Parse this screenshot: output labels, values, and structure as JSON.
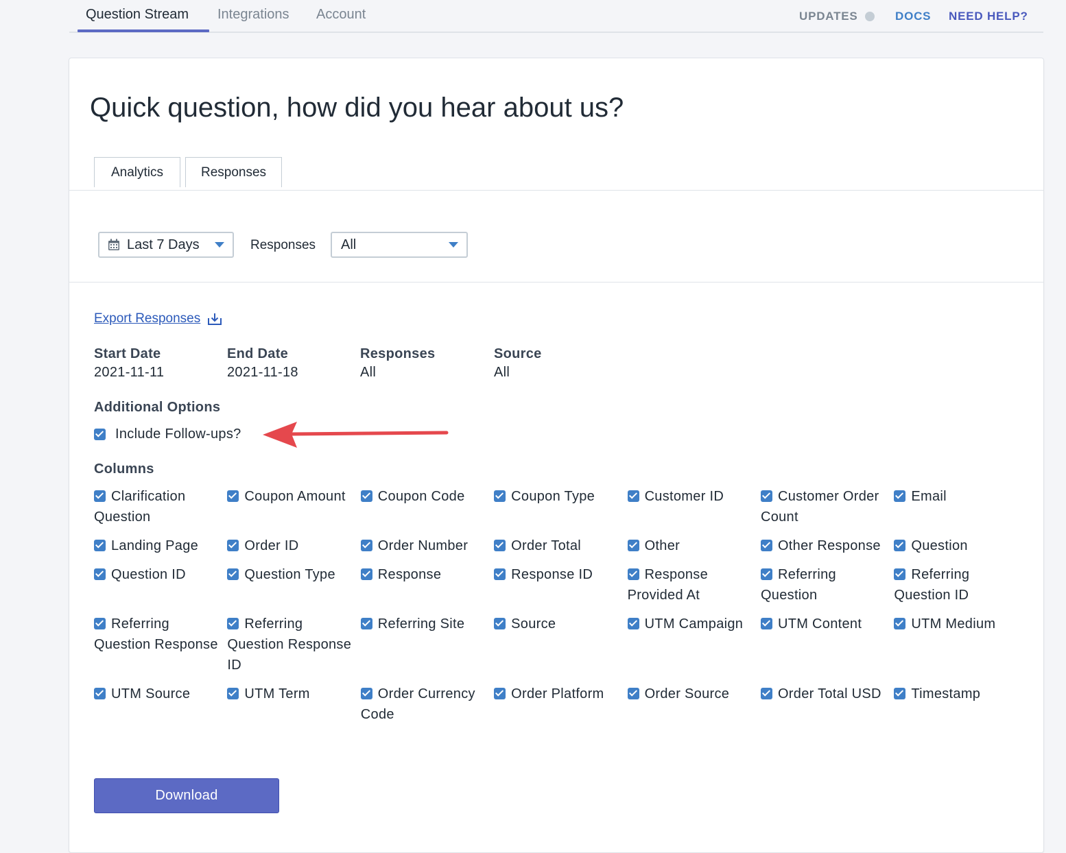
{
  "nav": {
    "tabs": [
      {
        "label": "Question Stream"
      },
      {
        "label": "Integrations"
      },
      {
        "label": "Account"
      }
    ],
    "updates": "UPDATES",
    "docs": "DOCS",
    "help": "NEED HELP?"
  },
  "page": {
    "title": "Quick question, how did you hear about us?"
  },
  "tabs": {
    "analytics": "Analytics",
    "responses": "Responses"
  },
  "filters": {
    "date_range": "Last 7 Days",
    "responses_label": "Responses",
    "responses_value": "All"
  },
  "export": {
    "label": "Export Responses"
  },
  "summary": {
    "start_date_label": "Start Date",
    "start_date": "2021-11-11",
    "end_date_label": "End Date",
    "end_date": "2021-11-18",
    "responses_label": "Responses",
    "responses": "All",
    "source_label": "Source",
    "source": "All"
  },
  "options": {
    "heading": "Additional Options",
    "include_followups": "Include Follow-ups?"
  },
  "columns": {
    "heading": "Columns",
    "items": [
      "Clarification Question",
      "Coupon Amount",
      "Coupon Code",
      "Coupon Type",
      "Customer ID",
      "Customer Order Count",
      "Email",
      "Landing Page",
      "Order ID",
      "Order Number",
      "Order Total",
      "Other",
      "Other Response",
      "Question",
      "Question ID",
      "Question Type",
      "Response",
      "Response ID",
      "Response Provided At",
      "Referring Question",
      "Referring Question ID",
      "Referring Question Response",
      "Referring Question Response ID",
      "Referring Site",
      "Source",
      "UTM Campaign",
      "UTM Content",
      "UTM Medium",
      "UTM Source",
      "UTM Term",
      "Order Currency Code",
      "Order Platform",
      "Order Source",
      "Order Total USD",
      "Timestamp"
    ]
  },
  "actions": {
    "download": "Download"
  },
  "colors": {
    "accent": "#5c6ac4",
    "checkbox": "#3f7fc7",
    "annotation_arrow": "#e5484d"
  }
}
